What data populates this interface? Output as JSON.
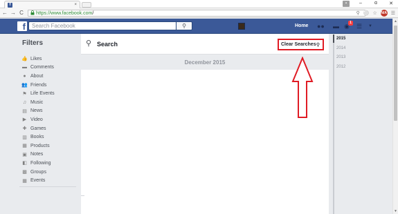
{
  "browser": {
    "tab_icon": "f",
    "tab_close": "×",
    "url_green": "https://www.facebook.com",
    "url_rest": "/",
    "back": "←",
    "forward": "→",
    "reload": "C",
    "lock": "🔒",
    "window_controls": {
      "user": "▪",
      "minimize": "–",
      "maximize": "ɑ",
      "close": "✕"
    },
    "addr_icons": [
      "zoom-icon",
      "extension-icon",
      "star-icon",
      "profile-extension-icon",
      "menu-icon"
    ],
    "ext_badge": "N/A"
  },
  "fb": {
    "logo": "f",
    "search_placeholder": "Search Facebook",
    "search_button_icon": "search-icon",
    "home": "Home",
    "notif_count": "1"
  },
  "filters": {
    "title": "Filters",
    "items": [
      {
        "label": "Likes",
        "icon": "👍"
      },
      {
        "label": "Comments",
        "icon": "▬"
      },
      {
        "label": "About",
        "icon": "●"
      },
      {
        "label": "Friends",
        "icon": "👥"
      },
      {
        "label": "Life Events",
        "icon": "⚑"
      },
      {
        "label": "Music",
        "icon": "♫"
      },
      {
        "label": "News",
        "icon": "▤"
      },
      {
        "label": "Video",
        "icon": "▶"
      },
      {
        "label": "Games",
        "icon": "✚"
      },
      {
        "label": "Books",
        "icon": "▥"
      },
      {
        "label": "Products",
        "icon": "▦"
      },
      {
        "label": "Notes",
        "icon": "▣"
      },
      {
        "label": "Following",
        "icon": "◧"
      },
      {
        "label": "Groups",
        "icon": "▩"
      },
      {
        "label": "Events",
        "icon": "▦"
      }
    ]
  },
  "main": {
    "title": "Search",
    "clear_button": "Clear Searches",
    "month": "December 2015"
  },
  "years": [
    "2015",
    "2014",
    "2013",
    "2012"
  ],
  "colors": {
    "fb_blue": "#3b5998",
    "annotation_red": "#e01b24"
  }
}
